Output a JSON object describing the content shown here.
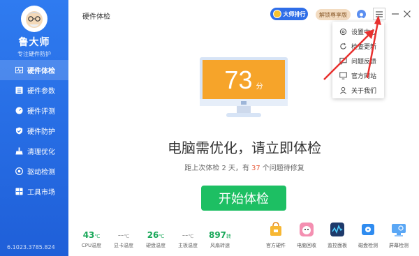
{
  "app": {
    "name": "鲁大师",
    "tagline": "专注硬件防护",
    "version": "6.1023.3785.824"
  },
  "sidebar": {
    "items": [
      {
        "label": "硬件体检",
        "active": true
      },
      {
        "label": "硬件参数",
        "active": false
      },
      {
        "label": "硬件评测",
        "active": false
      },
      {
        "label": "硬件防护",
        "active": false
      },
      {
        "label": "清理优化",
        "active": false
      },
      {
        "label": "驱动检测",
        "active": false
      },
      {
        "label": "工具市场",
        "active": false
      }
    ]
  },
  "header": {
    "title": "硬件体检",
    "rank_label": "大师排行",
    "vip_label": "解锁尊享版"
  },
  "menu": {
    "items": [
      "设置中心",
      "检查更新",
      "问题反馈",
      "官方网站",
      "关于我们"
    ]
  },
  "main": {
    "score": "73",
    "score_unit": "分",
    "headline": "电脑需优化，请立即体检",
    "sub_prefix": "距上次体检 2 天，有",
    "issue_count": "37",
    "sub_suffix": "个问题待修复",
    "start_button": "开始体检"
  },
  "stats": [
    {
      "value": "43",
      "unit": "℃",
      "label": "CPU温度"
    },
    {
      "value": "--",
      "unit": "℃",
      "label": "显卡温度"
    },
    {
      "value": "26",
      "unit": "℃",
      "label": "硬盘温度"
    },
    {
      "value": "--",
      "unit": "℃",
      "label": "主板温度"
    },
    {
      "value": "897",
      "unit": "转",
      "label": "风扇转速"
    }
  ],
  "tools": [
    {
      "label": "官方硬件"
    },
    {
      "label": "电脑回收"
    },
    {
      "label": "监控面板"
    },
    {
      "label": "磁盘检测"
    },
    {
      "label": "屏幕检测"
    }
  ],
  "colors": {
    "sidebar": "#2f7bf0",
    "accent_green": "#1dbf63",
    "score_orange": "#f6a42a",
    "highlight": "#e85a3a",
    "arrow_red": "#e8312f"
  }
}
